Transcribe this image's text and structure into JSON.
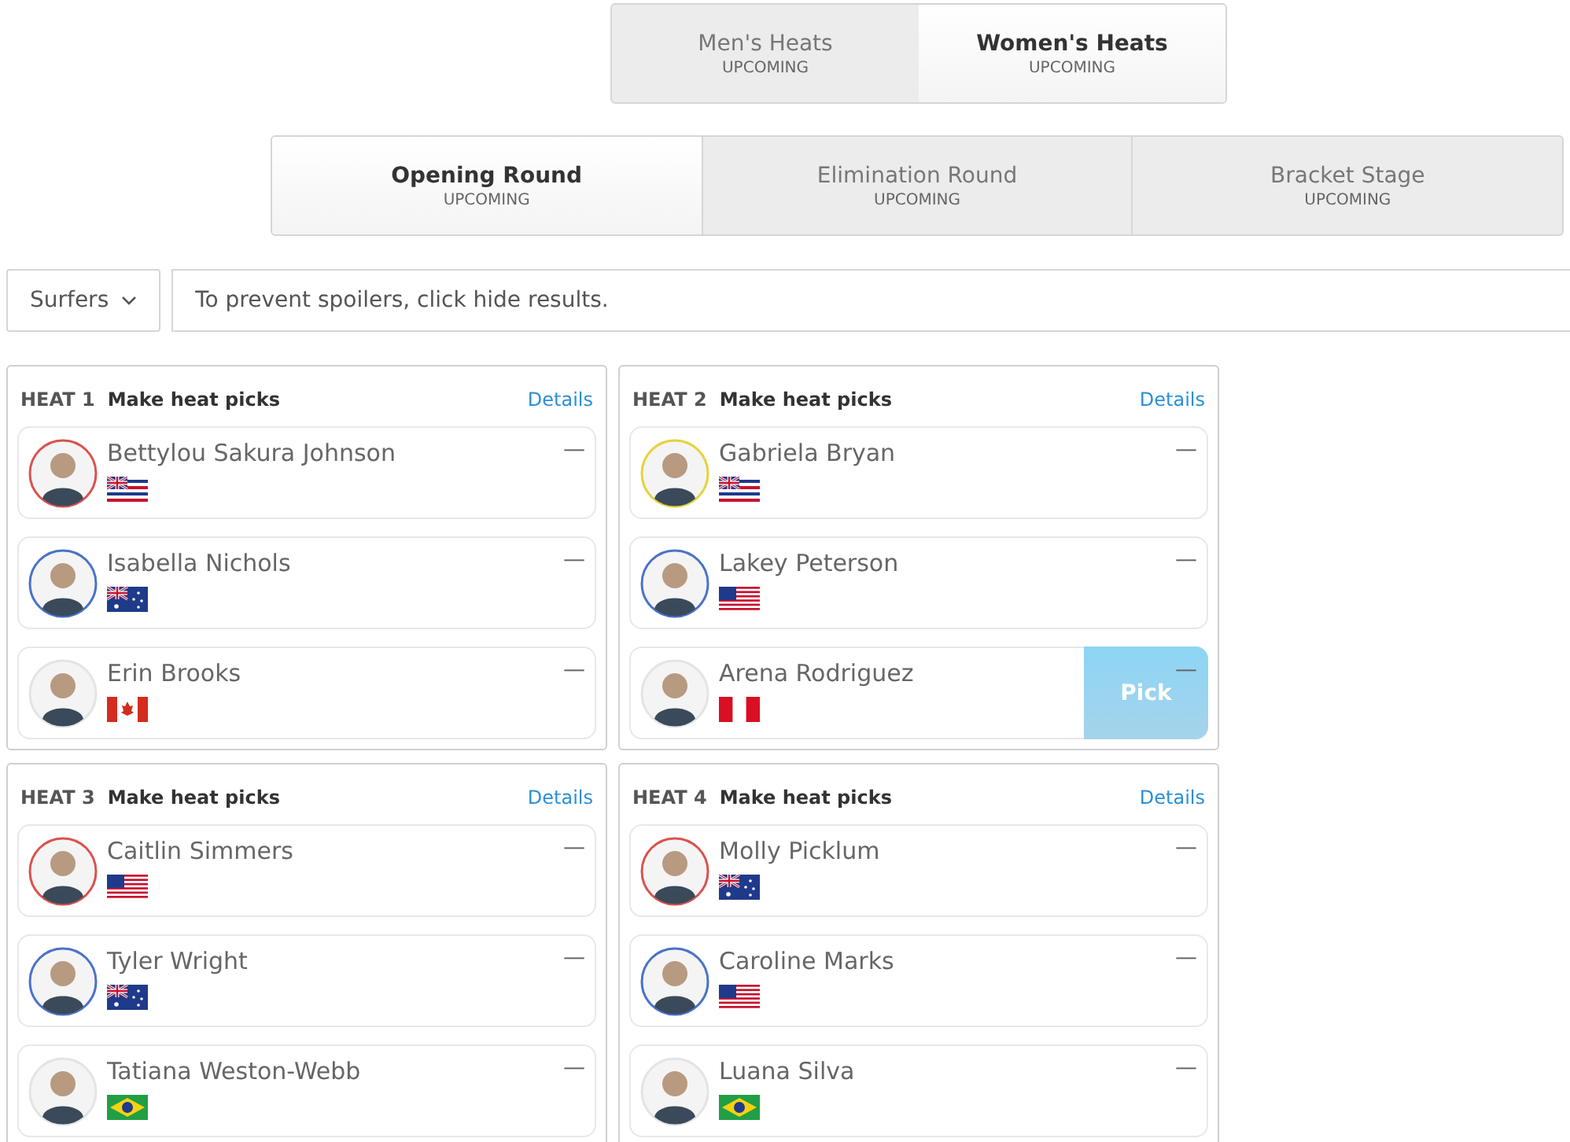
{
  "gender_tabs": [
    {
      "label": "Men's Heats",
      "status": "UPCOMING",
      "selected": false
    },
    {
      "label": "Women's Heats",
      "status": "UPCOMING",
      "selected": true
    }
  ],
  "round_tabs": [
    {
      "label": "Opening Round",
      "status": "UPCOMING",
      "selected": true
    },
    {
      "label": "Elimination Round",
      "status": "UPCOMING",
      "selected": false
    },
    {
      "label": "Bracket Stage",
      "status": "UPCOMING",
      "selected": false
    }
  ],
  "filter": {
    "dropdown": "Surfers",
    "message": "To prevent spoilers, click hide results."
  },
  "heats": [
    {
      "number": "HEAT 1",
      "title": "Make heat picks",
      "link": "Details",
      "surfers": [
        {
          "name": "Bettylou Sakura Johnson",
          "kind": "hawaii",
          "color": "#d9534f",
          "score": "—",
          "hovered": false
        },
        {
          "name": "Isabella Nichols",
          "kind": "australia",
          "color": "#4a72c9",
          "score": "—",
          "hovered": false
        },
        {
          "name": "Erin Brooks",
          "kind": "canada",
          "score": "—",
          "hovered": false
        }
      ]
    },
    {
      "number": "HEAT 2",
      "title": "Make heat picks",
      "link": "Details",
      "surfers": [
        {
          "name": "Gabriela Bryan",
          "kind": "hawaii",
          "color": "#e6d23a",
          "score": "—",
          "hovered": false
        },
        {
          "name": "Lakey Peterson",
          "kind": "usa",
          "color": "#4a72c9",
          "score": "—",
          "hovered": false
        },
        {
          "name": "Arena Rodriguez",
          "kind": "peru",
          "score": "—",
          "hovered": true,
          "pick_label": "Pick"
        }
      ]
    },
    {
      "number": "HEAT 3",
      "title": "Make heat picks",
      "link": "Details",
      "surfers": [
        {
          "name": "Caitlin Simmers",
          "kind": "usa",
          "color": "#d9534f",
          "score": "—",
          "hovered": false
        },
        {
          "name": "Tyler Wright",
          "kind": "australia",
          "color": "#4a72c9",
          "score": "—",
          "hovered": false
        },
        {
          "name": "Tatiana Weston-Webb",
          "kind": "brazil",
          "score": "—",
          "hovered": false
        }
      ]
    },
    {
      "number": "HEAT 4",
      "title": "Make heat picks",
      "link": "Details",
      "surfers": [
        {
          "name": "Molly Picklum",
          "kind": "australia",
          "color": "#d9534f",
          "score": "—",
          "hovered": false
        },
        {
          "name": "Caroline Marks",
          "kind": "usa",
          "color": "#4a72c9",
          "score": "—",
          "hovered": false
        },
        {
          "name": "Luana Silva",
          "kind": "brazil",
          "score": "—",
          "hovered": false
        }
      ]
    }
  ]
}
